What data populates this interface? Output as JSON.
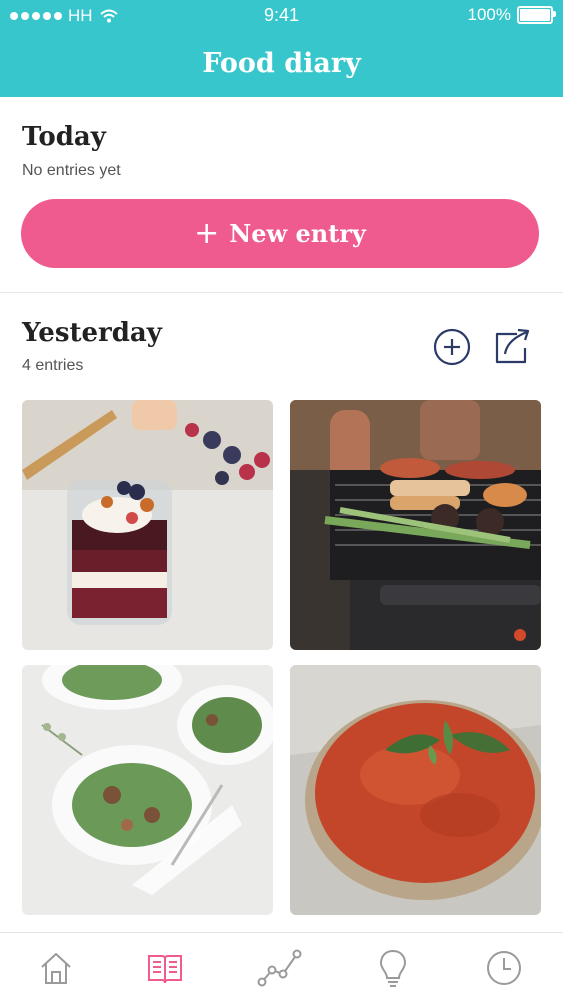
{
  "status_bar": {
    "carrier": "HH",
    "time": "9:41",
    "battery": "100%"
  },
  "header": {
    "title": "Food diary"
  },
  "today": {
    "title": "Today",
    "subtitle": "No entries yet",
    "new_entry_label": "New entry"
  },
  "yesterday": {
    "title": "Yesterday",
    "subtitle": "4 entries",
    "actions": [
      "add-icon",
      "share-icon"
    ],
    "photos": [
      {
        "name": "parfait-photo"
      },
      {
        "name": "grill-photo"
      },
      {
        "name": "salad-photo"
      },
      {
        "name": "tart-photo"
      }
    ]
  },
  "tabbar": {
    "tabs": [
      {
        "icon": "home-icon",
        "active": false
      },
      {
        "icon": "book-icon",
        "active": true
      },
      {
        "icon": "chart-icon",
        "active": false
      },
      {
        "icon": "bulb-icon",
        "active": false
      },
      {
        "icon": "clock-icon",
        "active": false
      }
    ]
  },
  "colors": {
    "header": "#36c6cb",
    "primary_button": "#ef5b8f",
    "icon_navy": "#2b3a67",
    "active_tab": "#ef5b8f",
    "inactive_tab": "#9a9a9a"
  }
}
